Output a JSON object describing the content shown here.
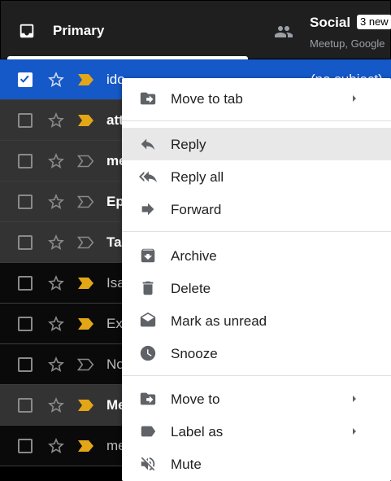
{
  "tabs": {
    "primary": {
      "label": "Primary"
    },
    "social": {
      "label": "Social",
      "badge": "3 new",
      "preview": "Meetup, Google"
    }
  },
  "emails": [
    {
      "sender": "ido",
      "state": "selected",
      "important": true,
      "checked": true,
      "right_text": "(no subject)"
    },
    {
      "sender": "att",
      "state": "read",
      "important": true,
      "bold": true
    },
    {
      "sender": "me",
      "state": "read",
      "important": false,
      "bold": true
    },
    {
      "sender": "Ep",
      "state": "read",
      "important": false,
      "bold": true
    },
    {
      "sender": "Ta",
      "state": "read",
      "important": false,
      "bold": true
    },
    {
      "sender": "Isa",
      "state": "unread",
      "important": true,
      "bold": false
    },
    {
      "sender": "Ex",
      "state": "unread",
      "important": true,
      "bold": false
    },
    {
      "sender": "No",
      "state": "unread",
      "important": false,
      "bold": false
    },
    {
      "sender": "Me",
      "state": "read",
      "important": true,
      "bold": true
    },
    {
      "sender": "me",
      "state": "unread",
      "important": true,
      "bold": false
    }
  ],
  "menu": {
    "move_to_tab": "Move to tab",
    "reply": "Reply",
    "reply_all": "Reply all",
    "forward": "Forward",
    "archive": "Archive",
    "delete": "Delete",
    "mark_unread": "Mark as unread",
    "snooze": "Snooze",
    "move_to": "Move to",
    "label_as": "Label as",
    "mute": "Mute"
  },
  "colors": {
    "selected_row": "#1558c7",
    "important_marker": "#e3a617",
    "menu_hover": "#e8e8e8"
  }
}
